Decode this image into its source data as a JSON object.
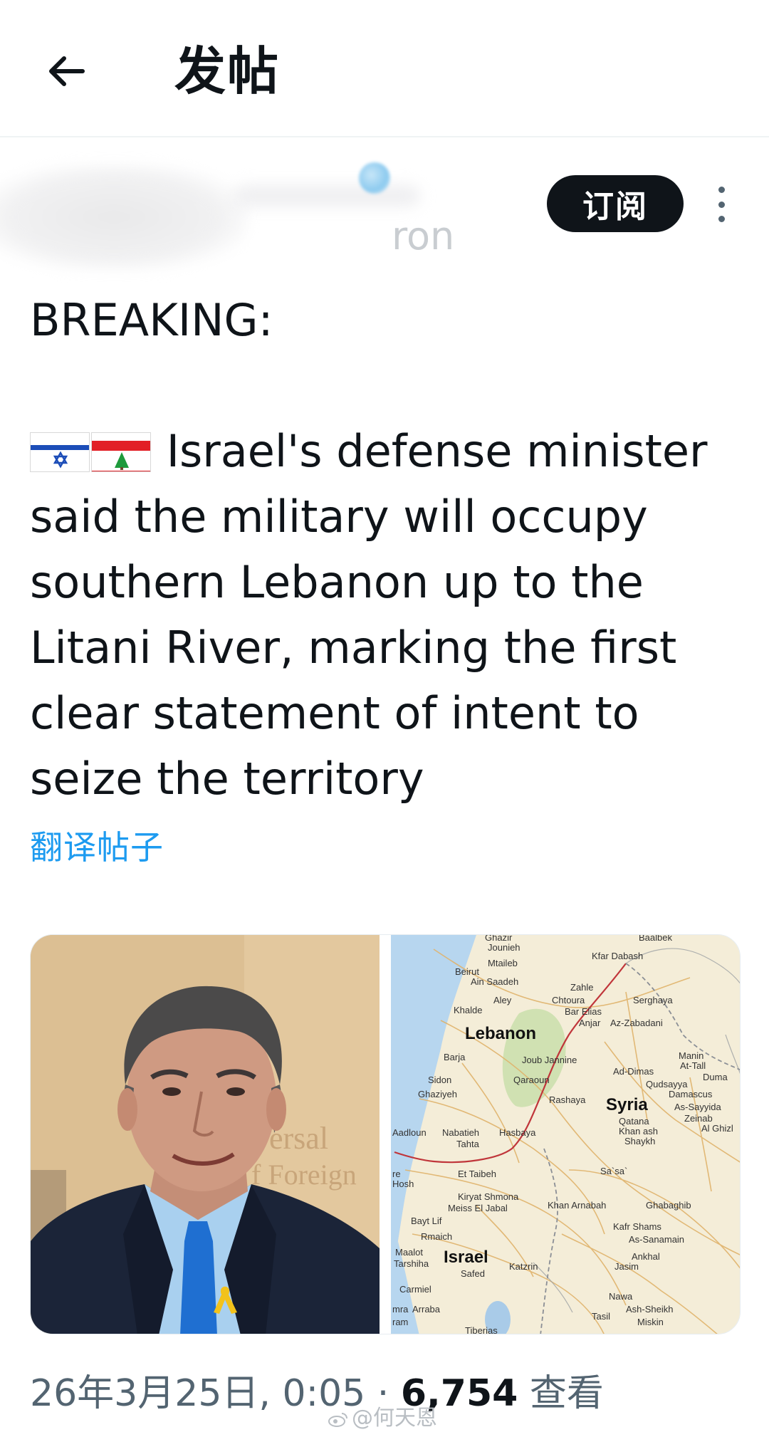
{
  "header": {
    "title": "发帖",
    "back_icon": "arrow-left-icon"
  },
  "author": {
    "handle_visible": "ron",
    "subscribe_label": "订阅",
    "more_icon": "more-vertical-icon"
  },
  "post": {
    "lines": [
      "BREAKING:",
      "",
      "Israel's defense minister",
      "said the military will occupy",
      "southern Lebanon up to the",
      "Litani River, marking the first",
      "clear statement of intent to",
      "seize the territory"
    ],
    "flags": [
      "israel-flag-icon",
      "lebanon-flag-icon"
    ],
    "translate_label": "翻译帖子"
  },
  "media": {
    "photo": {
      "badge_text": "ersal",
      "badge_text2": "f Foreign"
    },
    "map": {
      "labels": {
        "lebanon": "Lebanon",
        "syria": "Syria",
        "israel": "Israel",
        "baalbek": "Baalbek",
        "jounieh": "Jounieh",
        "mtaileb": "Mtaileb",
        "beirut": "Beirut",
        "ain_saadeh": "Ain Saadeh",
        "kfar_dabash": "Kfar Dabash",
        "zahle": "Zahle",
        "aley": "Aley",
        "chtoura": "Chtoura",
        "khalde": "Khalde",
        "bar_elias": "Bar Elias",
        "serghaya": "Serghaya",
        "anjar": "Anjar",
        "az_zabadani": "Az-Zabadani",
        "barja": "Barja",
        "joub_jannine": "Joub Jannine",
        "manin": "Manin",
        "at_tall": "At-Tall",
        "ad_dimas": "Ad-Dimas",
        "duma": "Duma",
        "sidon": "Sidon",
        "qaraoun": "Qaraoun",
        "qudsayya": "Qudsayya",
        "damascus": "Damascus",
        "ghaziyeh": "Ghaziyeh",
        "rashaya": "Rashaya",
        "as_sayyida": "As-Sayyida",
        "zeinab": "Zeinab",
        "qatana": "Qatana",
        "al_ghizl": "Al Ghizl",
        "khan_ash": "Khan ash",
        "shaykh": "Shaykh",
        "aadloun": "Aadloun",
        "nabatieh": "Nabatieh",
        "hasbaya": "Hasbaya",
        "tahta": "Tahta",
        "re": "re",
        "hosh": "Hosh",
        "et_taibeh": "Et Taibeh",
        "sa_sa": "Sa`sa`",
        "kiryat_shmona": "Kiryat Shmona",
        "meiss_el_jabal": "Meiss El Jabal",
        "khan_arnabah": "Khan Arnabah",
        "ghabaghib": "Ghabaghib",
        "bayt_lif": "Bayt Lif",
        "rmaich": "Rmaich",
        "kafr_shams": "Kafr Shams",
        "as_sanamain": "As-Sanamain",
        "maalot": "Maalot",
        "tarshiha": "Tarshiha",
        "katzrin": "Katzrin",
        "ankhal": "Ankhal",
        "jasim": "Jasim",
        "safed": "Safed",
        "carmiel": "Carmiel",
        "nawa": "Nawa",
        "arraba": "Arraba",
        "mra": "mra",
        "tasil": "Tasil",
        "ash_sheikh": "Ash-Sheikh",
        "miskin": "Miskin",
        "ram": "ram",
        "tiberias": "Tiberias",
        "ghazir": "Ghazir"
      }
    }
  },
  "footer": {
    "date": "26年3月25日, 0:05 · ",
    "views_count": "6,754",
    "views_label": " 查看",
    "watermark": "@何天恩"
  },
  "colors": {
    "link": "#1d9bf0",
    "text": "#0f1419",
    "secondary": "#536471",
    "button_bg": "#0f1419"
  }
}
